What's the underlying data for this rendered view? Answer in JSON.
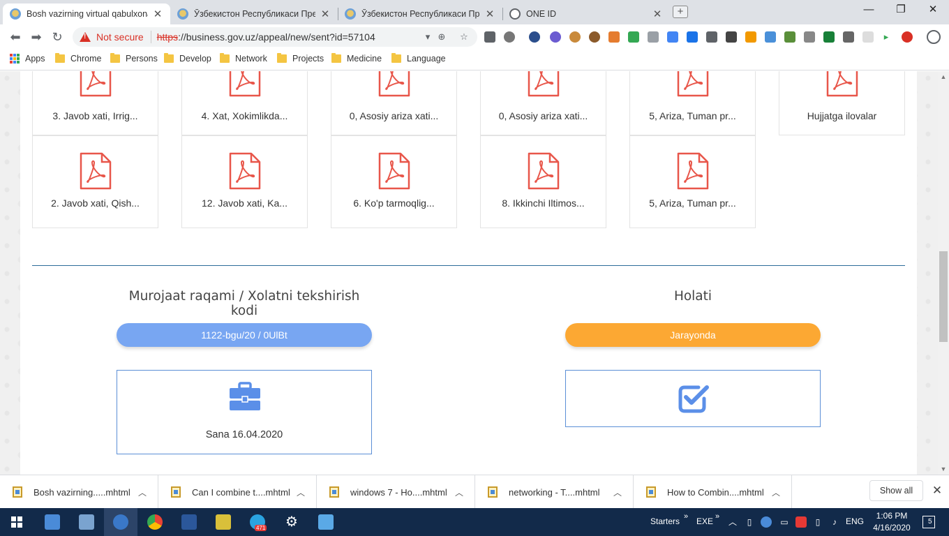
{
  "browser": {
    "tabs": [
      {
        "title": "Bosh vazirning virtual qabulxonasi",
        "active": true
      },
      {
        "title": "Ўзбекистон Республикаси Президенти",
        "active": false
      },
      {
        "title": "Ўзбекистон Республикаси Президенти",
        "active": false
      },
      {
        "title": "ONE ID",
        "active": false
      }
    ],
    "omnibox": {
      "security_label": "Not secure",
      "url_scheme": "https",
      "url_rest": "://business.gov.uz/appeal/new/sent?id=57104"
    },
    "bookmarks": [
      "Apps",
      "Chrome",
      "Persons",
      "Develop",
      "Network",
      "Projects",
      "Medicine",
      "Language"
    ]
  },
  "page": {
    "files_row1": [
      "3. Javob xati, Irrig...",
      "4. Xat, Xokimlikda...",
      "0, Asosiy ariza xati...",
      "0, Asosiy ariza xati...",
      "5, Ariza, Tuman pr...",
      "Hujjatga ilovalar"
    ],
    "files_row2": [
      "2. Javob xati, Qish...",
      "12. Javob xati, Ka...",
      "6. Ko'p tarmoqlig...",
      "8. Ikkinchi Iltimos...",
      "5, Ariza, Tuman pr..."
    ],
    "appeal": {
      "number_title": "Murojaat raqami / Xolatni tekshirish kodi",
      "number_value": "1122-bgu/20 / 0UlBt",
      "date_label": "Sana 16.04.2020"
    },
    "status": {
      "title": "Holati",
      "value": "Jarayonda"
    },
    "colors": {
      "pdf_red": "#e8564a",
      "pill_blue": "#78a6f2",
      "pill_orange": "#fca833",
      "divider": "#2d6c9a",
      "icon_blue": "#5b8fe8"
    }
  },
  "downloads": {
    "items": [
      "Bosh vazirning.....mhtml",
      "Can I combine t....mhtml",
      "windows 7 - Ho....mhtml",
      "networking - T....mhtml",
      "How to Combin....mhtml"
    ],
    "show_all": "Show all"
  },
  "taskbar": {
    "starters": "Starters",
    "exe": "EXE",
    "language": "ENG",
    "telegram_badge": "471",
    "notif_count": "5",
    "time": "1:06 PM",
    "date": "4/16/2020"
  }
}
